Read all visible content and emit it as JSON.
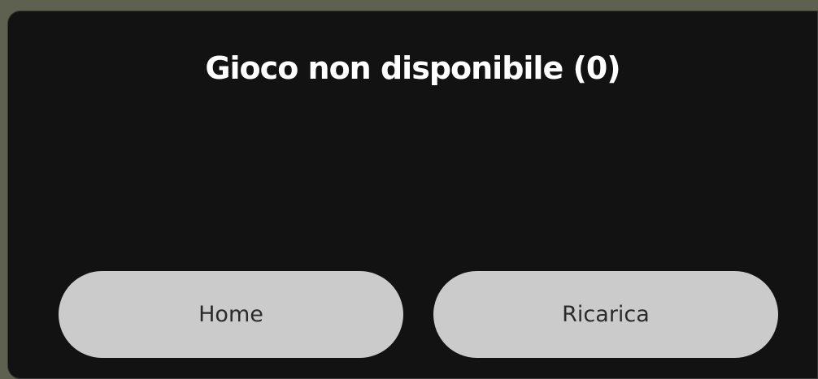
{
  "dialog": {
    "title": "Gioco non disponibile (0)",
    "buttons": {
      "home": "Home",
      "reload": "Ricarica"
    }
  },
  "colors": {
    "backdrop": "#5f6150",
    "dialog_background": "#121212",
    "title_text": "#ffffff",
    "button_background": "#cbcbcb",
    "button_text": "#2a2a2a"
  }
}
